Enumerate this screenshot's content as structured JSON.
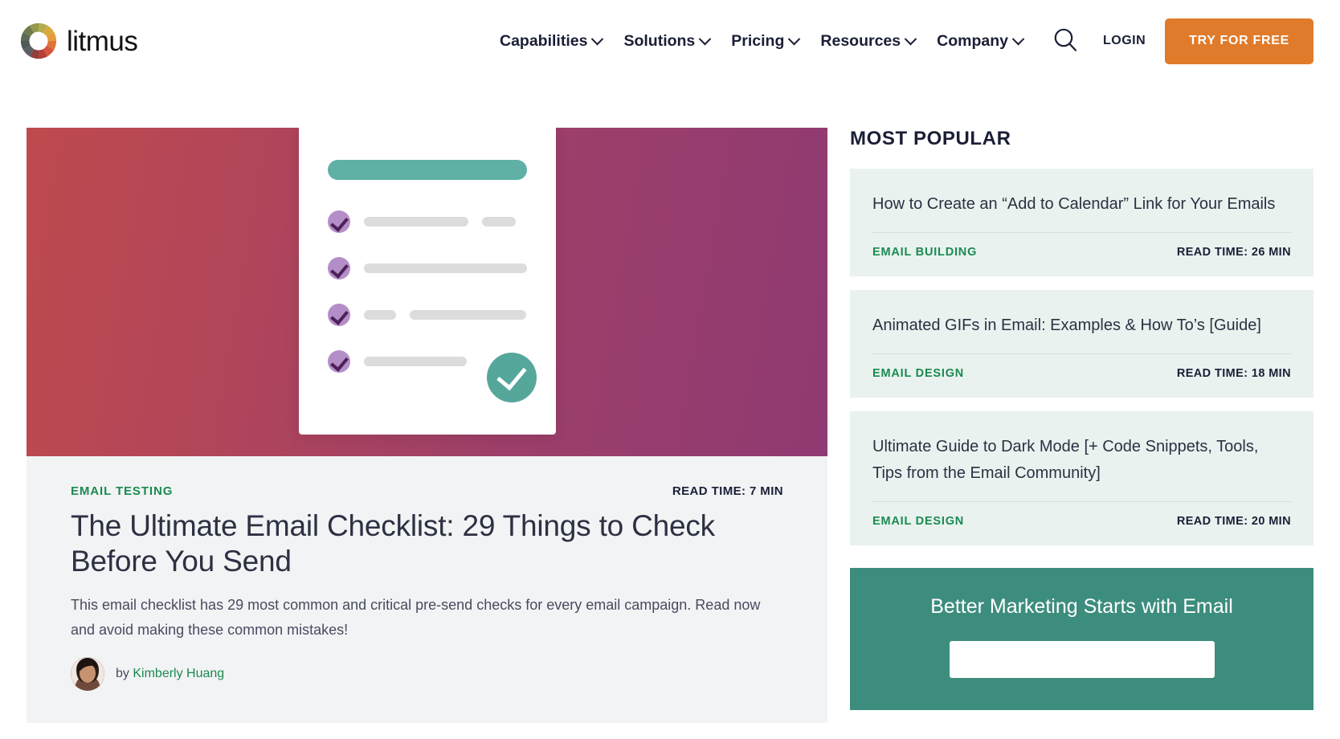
{
  "header": {
    "logo_text": "litmus",
    "logo_icon": "color-wheel-icon",
    "nav": [
      {
        "label": "Capabilities",
        "has_dropdown": true
      },
      {
        "label": "Solutions",
        "has_dropdown": true
      },
      {
        "label": "Pricing",
        "has_dropdown": true
      },
      {
        "label": "Resources",
        "has_dropdown": true
      },
      {
        "label": "Company",
        "has_dropdown": true
      }
    ],
    "search_icon": "search-icon",
    "login_label": "LOGIN",
    "cta_label": "TRY FOR FREE",
    "cta_color": "#e07b2b"
  },
  "featured": {
    "category": "EMAIL TESTING",
    "read_time": "READ TIME: 7 MIN",
    "title": "The Ultimate Email Checklist: 29 Things to Check Before You Send",
    "description": "This email checklist has 29 most common and critical pre-send checks for every email campaign. Read now and avoid making these common mistakes!",
    "byline_prefix": "by",
    "author": "Kimberly Huang",
    "hero_gradient_from": "#bf4a4e",
    "hero_gradient_to": "#8f3a73",
    "accent_teal": "#5fb0a5",
    "accent_purple": "#b48ec9"
  },
  "sidebar": {
    "heading": "MOST POPULAR",
    "cards": [
      {
        "title": "How to Create an “Add to Calendar” Link for Your Emails",
        "category": "EMAIL BUILDING",
        "read_time": "READ TIME: 26 MIN"
      },
      {
        "title": "Animated GIFs in Email: Examples & How To’s [Guide]",
        "category": "EMAIL DESIGN",
        "read_time": "READ TIME: 18 MIN"
      },
      {
        "title": "Ultimate Guide to Dark Mode [+ Code Snippets, Tools, Tips from the Email Community]",
        "category": "EMAIL DESIGN",
        "read_time": "READ TIME: 20 MIN"
      }
    ],
    "promo": {
      "title": "Better Marketing Starts with Email",
      "background": "#3d8d7e"
    },
    "category_color": "#1a8a50",
    "card_background": "#e9f2ef"
  }
}
